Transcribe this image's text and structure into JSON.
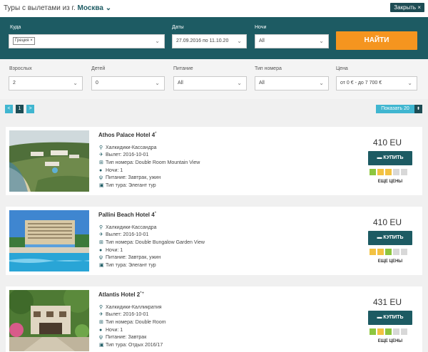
{
  "header": {
    "title_prefix": "Туры с вылетами из г.",
    "city": "Москва",
    "city_chevron": "⌄",
    "close_label": "Закрыть ×"
  },
  "filters": {
    "destination_label": "Куда",
    "destination_chip": "Греция ×",
    "dates_label": "Даты",
    "dates_value": "27.09.2016 по 11.10.20",
    "nights_label": "Ночи",
    "nights_value": "All",
    "find_label": "НАЙТИ",
    "adults_label": "Взрослых",
    "adults_value": "2",
    "children_label": "Детей",
    "children_value": "0",
    "meal_label": "Питание",
    "meal_value": "All",
    "room_label": "Тип номера",
    "room_value": "All",
    "price_label": "Цена",
    "price_value": "от 0 € - до 7 700 €",
    "chevron": "⌄"
  },
  "pagination": {
    "prev": "<",
    "page": "1",
    "next": ">",
    "show_label": "Показать 20",
    "show_arrow": "⬍"
  },
  "icons": {
    "location": "⚲",
    "plane": "✈",
    "room": "⊞",
    "night": "●",
    "meal": "ψ",
    "tour": "▣",
    "cart": "▬"
  },
  "hotels": [
    {
      "name": "Athos Palace Hotel 4",
      "star": "*",
      "location": "Халкидики-Кассандра",
      "departure": "Вылет: 2016-10-01",
      "room": "Тип номера: Double Room Mountain View",
      "nights": "Ночи: 1",
      "meal": "Питание: Завтрак, ужин",
      "tour": "Тип тура: Элегант тур",
      "price": "410 EU",
      "buy": "КУПИТЬ",
      "more": "ЕЩЕ ЦЕНЫ"
    },
    {
      "name": "Pallini Beach Hotel 4",
      "star": "*",
      "location": "Халкидики-Кассандра",
      "departure": "Вылет: 2016-10-01",
      "room": "Тип номера: Double Bungalow Garden View",
      "nights": "Ночи: 1",
      "meal": "Питание: Завтрак, ужин",
      "tour": "Тип тура: Элегант тур",
      "price": "410 EU",
      "buy": "КУПИТЬ",
      "more": "ЕЩЕ ЦЕНЫ"
    },
    {
      "name": "Atlantis Hotel 2",
      "star": "*+",
      "location": "Халкидики-Калликратия",
      "departure": "Вылет: 2016-10-01",
      "room": "Тип номера: Double Room",
      "nights": "Ночи: 1",
      "meal": "Питание: Завтрак",
      "tour": "Тип тура: Отдых 2016/17",
      "price": "431 EU",
      "buy": "КУПИТЬ",
      "more": "ЕЩЕ ЦЕНЫ"
    }
  ],
  "colors": {
    "panel": "#1d5b63",
    "accent_orange": "#f5951f",
    "accent_teal": "#40b6d0",
    "status_green": "#8dc63f",
    "status_yellow": "#f3c242",
    "status_gray": "#d8d8d8"
  }
}
